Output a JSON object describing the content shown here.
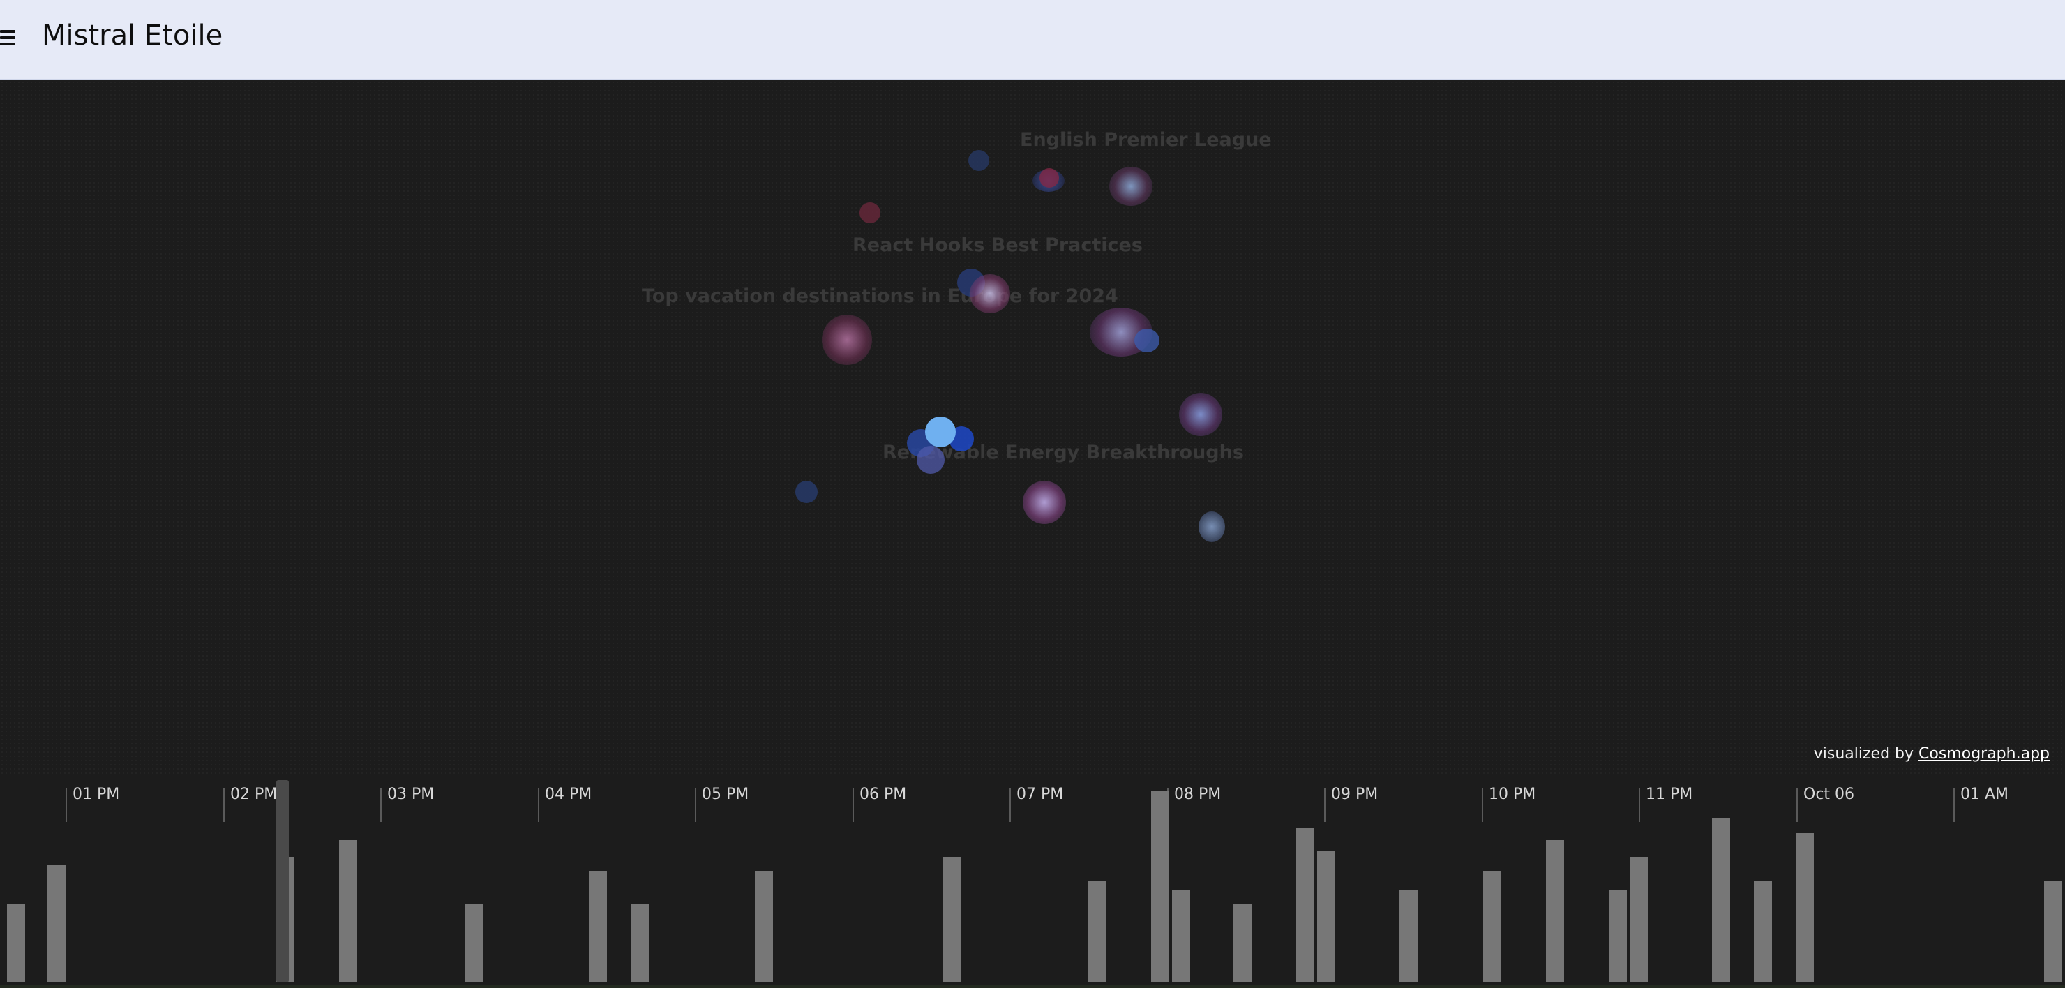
{
  "header": {
    "title": "Mistral Etoile",
    "menu_icon": "hamburger-menu-icon"
  },
  "graph": {
    "cluster_labels": [
      "English Premier League",
      "React Hooks Best Practices",
      "Top vacation destinations in Europe for 2024",
      "Renewable Energy Breakthroughs"
    ]
  },
  "credit": {
    "prefix": "visualized by ",
    "link_text": "Cosmograph.app"
  },
  "timeline": {
    "ticks": [
      "01 PM",
      "02 PM",
      "03 PM",
      "04 PM",
      "05 PM",
      "06 PM",
      "07 PM",
      "08 PM",
      "09 PM",
      "10 PM",
      "11 PM",
      "Oct 06",
      "01 AM"
    ],
    "bar_color": "#777777"
  }
}
